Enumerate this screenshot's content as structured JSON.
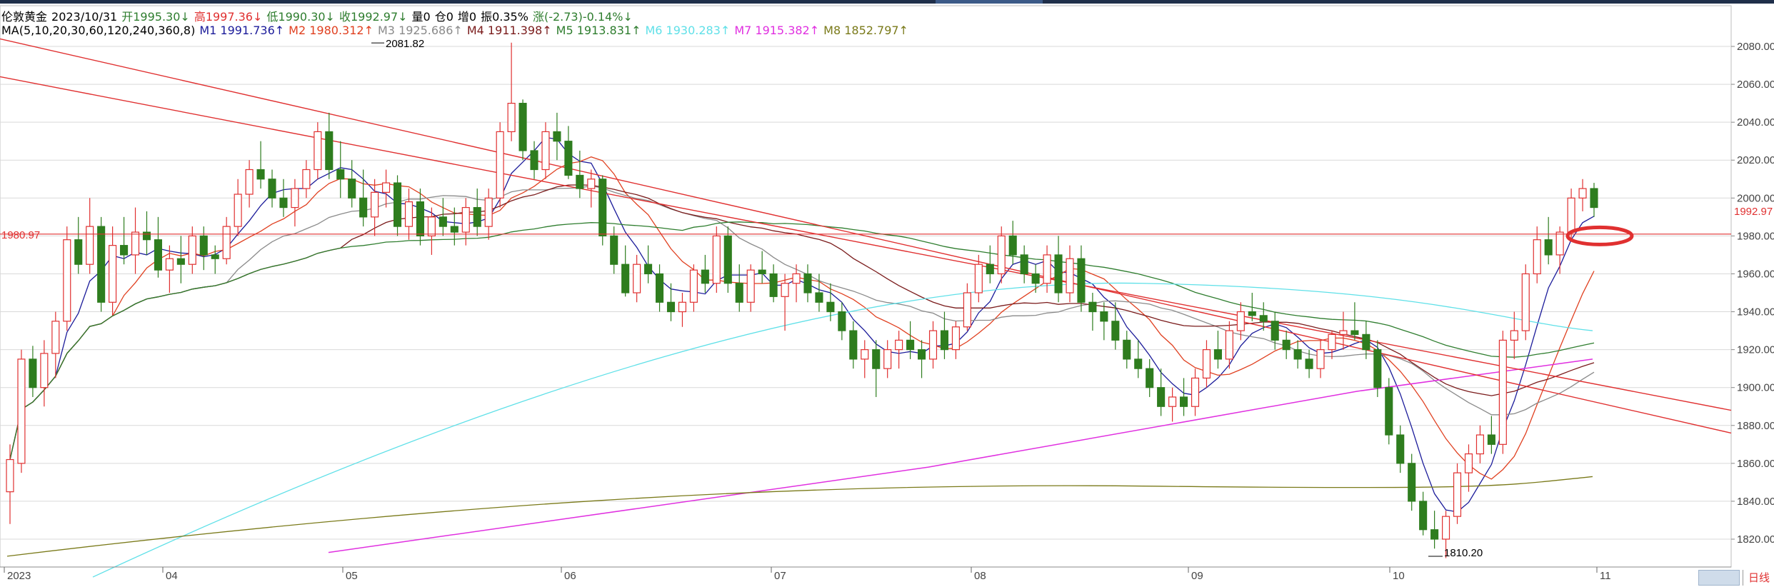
{
  "header": {
    "symbol": "伦敦黄金",
    "date": "2023/10/31",
    "open": "开1995.30↓",
    "high": "高1997.36↓",
    "low": "低1990.30↓",
    "close": "收1992.97↓",
    "volume": "量0",
    "open_interest": "仓0",
    "oi_change": "增0",
    "amplitude": "振0.35%",
    "change": "涨(-2.73)-0.14%↓"
  },
  "ma_legend": {
    "label": "MA(5,10,20,30,60,120,240,360,8)",
    "items": [
      {
        "text": "M1 1991.736↑",
        "color": "#1b1b9a"
      },
      {
        "text": "M2 1980.312↑",
        "color": "#e04020"
      },
      {
        "text": "M3 1925.686↑",
        "color": "#8a8a8a"
      },
      {
        "text": "M4 1911.398↑",
        "color": "#7a1b1b"
      },
      {
        "text": "M5 1913.831↑",
        "color": "#2e7d2e"
      },
      {
        "text": "M6 1930.283↑",
        "color": "#5fe0e8"
      },
      {
        "text": "M7 1915.382↑",
        "color": "#e030e0"
      },
      {
        "text": "M8 1852.797↑",
        "color": "#7a7a1a"
      }
    ]
  },
  "colors": {
    "up": "#e03030",
    "down": "#2e7d1e",
    "grid": "#d9d9d9",
    "trendline": "#e03030",
    "price_marker": "#e03030"
  },
  "chart_data": {
    "type": "candlestick",
    "x_axis_labels": [
      "2023",
      "04",
      "05",
      "06",
      "07",
      "08",
      "09",
      "10",
      "11"
    ],
    "y_ticks": [
      "2080.00",
      "2060.00",
      "2040.00",
      "2020.00",
      "2000.00",
      "1980.00",
      "1960.00",
      "1940.00",
      "1920.00",
      "1900.00",
      "1880.00",
      "1860.00",
      "1840.00",
      "1820.00"
    ],
    "ylim": [
      1813,
      2093
    ],
    "annotations": {
      "high_label": "2081.82",
      "low_label": "1810.20",
      "horizontal_line_label": "1980.97",
      "current_price_label": "1992.97"
    },
    "horizontal_line_value": 1980.97,
    "current_price": 1992.97,
    "candles_ohlc": [
      [
        1845,
        1870,
        1828,
        1862
      ],
      [
        1860,
        1920,
        1855,
        1915
      ],
      [
        1915,
        1922,
        1895,
        1900
      ],
      [
        1900,
        1925,
        1890,
        1918
      ],
      [
        1918,
        1940,
        1905,
        1935
      ],
      [
        1935,
        1985,
        1930,
        1978
      ],
      [
        1978,
        1990,
        1960,
        1965
      ],
      [
        1965,
        2000,
        1960,
        1985
      ],
      [
        1985,
        1990,
        1940,
        1945
      ],
      [
        1945,
        1985,
        1938,
        1975
      ],
      [
        1975,
        1990,
        1965,
        1970
      ],
      [
        1970,
        1995,
        1960,
        1982
      ],
      [
        1982,
        1993,
        1970,
        1978
      ],
      [
        1978,
        1990,
        1958,
        1962
      ],
      [
        1962,
        1975,
        1950,
        1968
      ],
      [
        1968,
        1980,
        1955,
        1965
      ],
      [
        1965,
        1985,
        1960,
        1980
      ],
      [
        1980,
        1985,
        1962,
        1970
      ],
      [
        1970,
        1975,
        1960,
        1968
      ],
      [
        1968,
        1990,
        1965,
        1985
      ],
      [
        1985,
        2010,
        1980,
        2002
      ],
      [
        2002,
        2020,
        1995,
        2015
      ],
      [
        2015,
        2030,
        2005,
        2010
      ],
      [
        2010,
        2015,
        1995,
        2000
      ],
      [
        2000,
        2010,
        1990,
        1995
      ],
      [
        1995,
        2010,
        1985,
        2005
      ],
      [
        2005,
        2020,
        2000,
        2015
      ],
      [
        2015,
        2040,
        2010,
        2035
      ],
      [
        2035,
        2045,
        2010,
        2015
      ],
      [
        2015,
        2030,
        2000,
        2010
      ],
      [
        2010,
        2020,
        1995,
        2000
      ],
      [
        2000,
        2015,
        1985,
        1990
      ],
      [
        1990,
        2010,
        1980,
        2003
      ],
      [
        2003,
        2015,
        1995,
        2008
      ],
      [
        2008,
        2012,
        1980,
        1985
      ],
      [
        1985,
        2005,
        1978,
        1998
      ],
      [
        1998,
        2005,
        1975,
        1980
      ],
      [
        1980,
        1995,
        1970,
        1990
      ],
      [
        1990,
        2000,
        1980,
        1985
      ],
      [
        1985,
        1995,
        1975,
        1982
      ],
      [
        1982,
        2000,
        1975,
        1995
      ],
      [
        1995,
        2005,
        1980,
        1985
      ],
      [
        1985,
        2005,
        1978,
        2000
      ],
      [
        2000,
        2040,
        1995,
        2035
      ],
      [
        2035,
        2082,
        2030,
        2050
      ],
      [
        2050,
        2052,
        2020,
        2025
      ],
      [
        2025,
        2030,
        2010,
        2015
      ],
      [
        2015,
        2040,
        2010,
        2035
      ],
      [
        2035,
        2045,
        2020,
        2030
      ],
      [
        2030,
        2038,
        2010,
        2012
      ],
      [
        2012,
        2025,
        2000,
        2005
      ],
      [
        2005,
        2015,
        1995,
        2010
      ],
      [
        2010,
        2012,
        1975,
        1980
      ],
      [
        1980,
        1985,
        1960,
        1965
      ],
      [
        1965,
        1975,
        1948,
        1950
      ],
      [
        1950,
        1970,
        1945,
        1965
      ],
      [
        1965,
        1975,
        1955,
        1960
      ],
      [
        1960,
        1965,
        1940,
        1945
      ],
      [
        1945,
        1955,
        1935,
        1940
      ],
      [
        1940,
        1950,
        1932,
        1945
      ],
      [
        1945,
        1965,
        1940,
        1962
      ],
      [
        1962,
        1970,
        1950,
        1955
      ],
      [
        1955,
        1985,
        1950,
        1980
      ],
      [
        1980,
        1985,
        1950,
        1955
      ],
      [
        1955,
        1965,
        1940,
        1945
      ],
      [
        1945,
        1965,
        1940,
        1962
      ],
      [
        1962,
        1972,
        1955,
        1960
      ],
      [
        1960,
        1965,
        1945,
        1948
      ],
      [
        1948,
        1960,
        1930,
        1955
      ],
      [
        1955,
        1965,
        1945,
        1960
      ],
      [
        1960,
        1965,
        1945,
        1950
      ],
      [
        1950,
        1960,
        1940,
        1945
      ],
      [
        1945,
        1955,
        1935,
        1940
      ],
      [
        1940,
        1945,
        1925,
        1930
      ],
      [
        1930,
        1935,
        1910,
        1915
      ],
      [
        1915,
        1925,
        1905,
        1920
      ],
      [
        1920,
        1925,
        1895,
        1910
      ],
      [
        1910,
        1925,
        1905,
        1920
      ],
      [
        1920,
        1930,
        1910,
        1925
      ],
      [
        1925,
        1935,
        1915,
        1920
      ],
      [
        1920,
        1925,
        1905,
        1915
      ],
      [
        1915,
        1935,
        1910,
        1930
      ],
      [
        1930,
        1940,
        1915,
        1920
      ],
      [
        1920,
        1935,
        1915,
        1932
      ],
      [
        1932,
        1955,
        1930,
        1950
      ],
      [
        1950,
        1970,
        1945,
        1965
      ],
      [
        1965,
        1975,
        1955,
        1960
      ],
      [
        1960,
        1985,
        1955,
        1980
      ],
      [
        1980,
        1988,
        1965,
        1970
      ],
      [
        1970,
        1975,
        1955,
        1960
      ],
      [
        1960,
        1965,
        1950,
        1955
      ],
      [
        1955,
        1975,
        1950,
        1970
      ],
      [
        1970,
        1980,
        1945,
        1950
      ],
      [
        1950,
        1975,
        1945,
        1968
      ],
      [
        1968,
        1975,
        1940,
        1945
      ],
      [
        1945,
        1950,
        1930,
        1940
      ],
      [
        1940,
        1945,
        1925,
        1935
      ],
      [
        1935,
        1945,
        1920,
        1925
      ],
      [
        1925,
        1930,
        1910,
        1915
      ],
      [
        1915,
        1925,
        1905,
        1910
      ],
      [
        1910,
        1915,
        1895,
        1900
      ],
      [
        1900,
        1910,
        1885,
        1890
      ],
      [
        1890,
        1900,
        1882,
        1895
      ],
      [
        1895,
        1905,
        1885,
        1890
      ],
      [
        1890,
        1910,
        1885,
        1905
      ],
      [
        1905,
        1925,
        1900,
        1920
      ],
      [
        1920,
        1930,
        1910,
        1915
      ],
      [
        1915,
        1935,
        1910,
        1930
      ],
      [
        1930,
        1945,
        1925,
        1940
      ],
      [
        1940,
        1950,
        1935,
        1938
      ],
      [
        1938,
        1945,
        1930,
        1935
      ],
      [
        1935,
        1940,
        1920,
        1925
      ],
      [
        1925,
        1930,
        1915,
        1920
      ],
      [
        1920,
        1925,
        1910,
        1915
      ],
      [
        1915,
        1920,
        1905,
        1910
      ],
      [
        1910,
        1925,
        1905,
        1920
      ],
      [
        1920,
        1930,
        1915,
        1928
      ],
      [
        1928,
        1940,
        1920,
        1930
      ],
      [
        1930,
        1945,
        1925,
        1928
      ],
      [
        1928,
        1935,
        1915,
        1920
      ],
      [
        1920,
        1925,
        1895,
        1900
      ],
      [
        1900,
        1905,
        1870,
        1875
      ],
      [
        1875,
        1880,
        1855,
        1860
      ],
      [
        1860,
        1865,
        1835,
        1840
      ],
      [
        1840,
        1845,
        1822,
        1825
      ],
      [
        1825,
        1835,
        1815,
        1820
      ],
      [
        1820,
        1835,
        1810,
        1832
      ],
      [
        1832,
        1860,
        1828,
        1855
      ],
      [
        1855,
        1870,
        1845,
        1865
      ],
      [
        1865,
        1880,
        1860,
        1875
      ],
      [
        1875,
        1885,
        1865,
        1870
      ],
      [
        1870,
        1930,
        1865,
        1925
      ],
      [
        1925,
        1940,
        1915,
        1930
      ],
      [
        1930,
        1965,
        1925,
        1960
      ],
      [
        1960,
        1985,
        1955,
        1978
      ],
      [
        1978,
        1990,
        1965,
        1970
      ],
      [
        1970,
        1985,
        1960,
        1982
      ],
      [
        1982,
        2005,
        1978,
        2000
      ],
      [
        2000,
        2010,
        1993,
        2005
      ],
      [
        2005,
        2008,
        1990,
        1995
      ]
    ]
  }
}
